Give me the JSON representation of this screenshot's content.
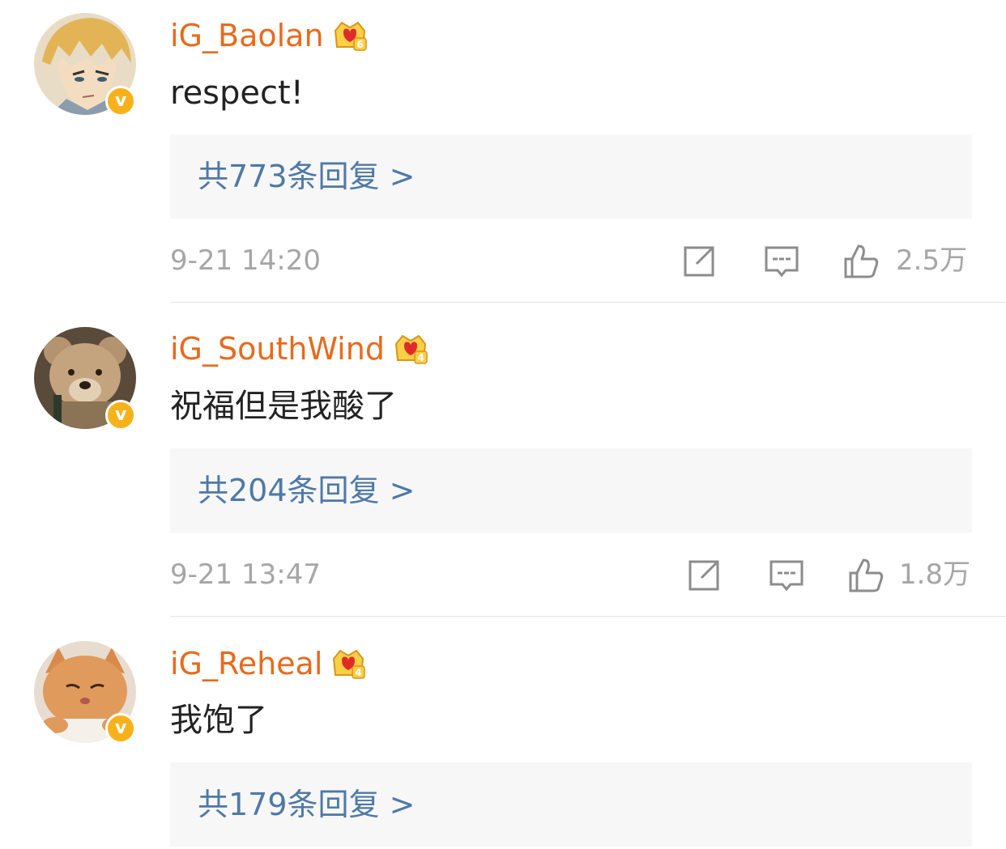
{
  "comments": [
    {
      "username": "iG_Baolan",
      "level_badge": "6",
      "verified_badge": "v",
      "avatar_icon": "anime-character-avatar",
      "text": "respect!",
      "replies_label": "共773条回复 >",
      "time": "9-21 14:20",
      "likes": "2.5万"
    },
    {
      "username": "iG_SouthWind",
      "level_badge": "4",
      "verified_badge": "v",
      "avatar_icon": "teddy-bear-avatar",
      "text": "祝福但是我酸了",
      "replies_label": "共204条回复 >",
      "time": "9-21 13:47",
      "likes": "1.8万"
    },
    {
      "username": "iG_Reheal",
      "level_badge": "4",
      "verified_badge": "v",
      "avatar_icon": "orange-cat-avatar",
      "text": "我饱了",
      "replies_label": "共179条回复 >",
      "time": "",
      "likes": ""
    }
  ],
  "colors": {
    "username": "#e86a1c",
    "reply_link": "#4e79a7",
    "meta_text": "#a6a6a6",
    "verified": "#f7b21b",
    "reply_bg": "#f7f7f7"
  }
}
